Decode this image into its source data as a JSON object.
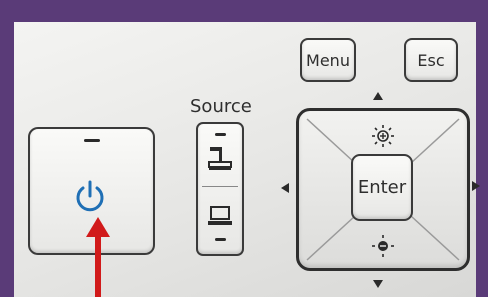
{
  "buttons": {
    "menu_label": "Menu",
    "esc_label": "Esc",
    "source_label": "Source",
    "enter_label": "Enter"
  },
  "icons": [
    "power-icon",
    "document-camera-icon",
    "laptop-icon",
    "brightness-up-icon",
    "brightness-down-icon"
  ],
  "colors": {
    "background": "#5a3b78",
    "power_icon": "#1f6fb5",
    "arrow": "#d11a1a"
  }
}
